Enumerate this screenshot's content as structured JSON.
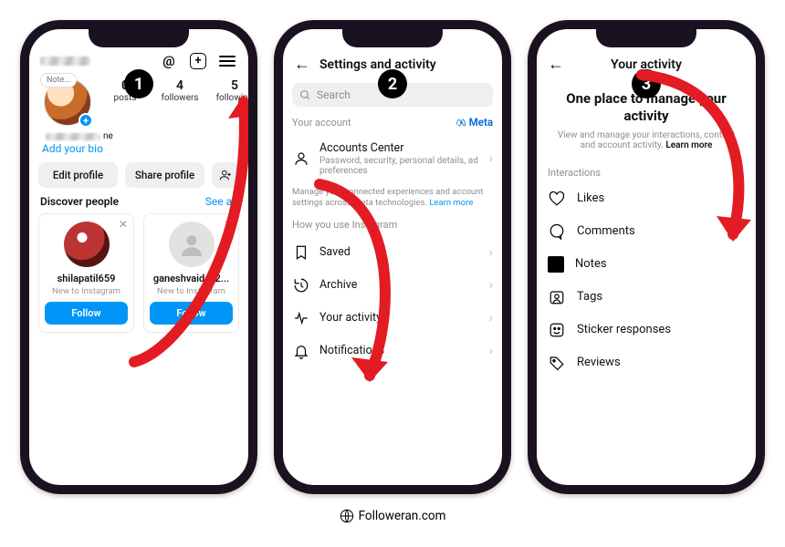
{
  "steps": [
    "1",
    "2",
    "3"
  ],
  "phone1": {
    "note": "Note...",
    "stats": {
      "posts": {
        "n": "0",
        "l": "posts"
      },
      "followers": {
        "n": "4",
        "l": "followers"
      },
      "following": {
        "n": "5",
        "l": "following"
      }
    },
    "displayname_suffix": "ne",
    "addbio": "Add your bio",
    "editprofile": "Edit profile",
    "shareprofile": "Share profile",
    "discover": "Discover people",
    "seeall": "See all",
    "cards": [
      {
        "name": "shilapatil659",
        "sub": "New to Instagram",
        "btn": "Follow"
      },
      {
        "name": "ganeshvaiday2...",
        "sub": "New to Instagram",
        "btn": "Follow"
      }
    ]
  },
  "phone2": {
    "title": "Settings and activity",
    "search_placeholder": "Search",
    "yourAccount": "Your account",
    "metaLabel": "Meta",
    "accountsCenter": {
      "t": "Accounts Center",
      "d": "Password, security, personal details, ad preferences"
    },
    "note": "Manage your connected experiences and account settings across Meta technologies.",
    "learnmore": "Learn more",
    "howYouUse": "How you use Instagram",
    "items": [
      {
        "t": "Saved"
      },
      {
        "t": "Archive"
      },
      {
        "t": "Your activity"
      },
      {
        "t": "Notifications"
      }
    ]
  },
  "phone3": {
    "title": "Your activity",
    "intro": "One place to manage your activity",
    "sub": "View and manage your interactions, content and account activity.",
    "learnmore": "Learn more",
    "section": "Interactions",
    "items": [
      {
        "t": "Likes"
      },
      {
        "t": "Comments"
      },
      {
        "t": "Notes"
      },
      {
        "t": "Tags"
      },
      {
        "t": "Sticker responses"
      },
      {
        "t": "Reviews"
      }
    ]
  },
  "watermark": "Followeran.com"
}
